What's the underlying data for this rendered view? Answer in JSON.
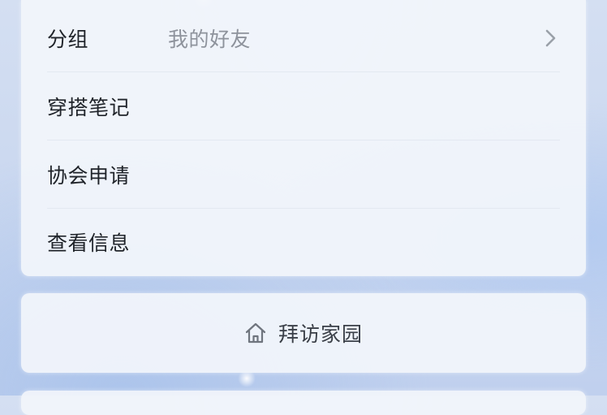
{
  "menu": {
    "rows": [
      {
        "label": "分组",
        "value": "我的好友",
        "icon": "chevron-right-icon"
      },
      {
        "label": "穿搭笔记"
      },
      {
        "label": "协会申请"
      },
      {
        "label": "查看信息"
      }
    ]
  },
  "visit": {
    "label": "拜访家园",
    "icon": "home-icon"
  },
  "colors": {
    "text_primary": "#1f2329",
    "text_secondary": "#8e939c",
    "card_background": "#f2f5fb"
  }
}
